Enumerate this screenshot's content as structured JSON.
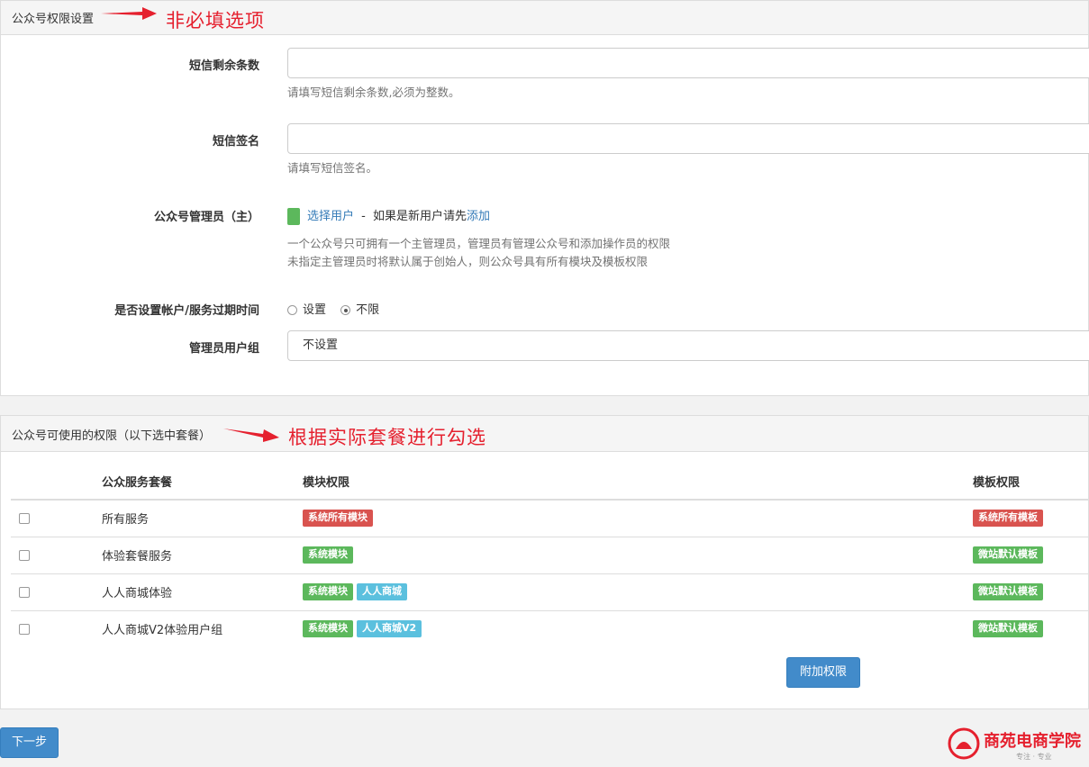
{
  "section1": {
    "title": "公众号权限设置",
    "annotation": "非必填选项",
    "sms_count": {
      "label": "短信剩余条数",
      "value": "",
      "help": "请填写短信剩余条数,必须为整数。"
    },
    "sms_sign": {
      "label": "短信签名",
      "value": "",
      "help": "请填写短信签名。"
    },
    "admin": {
      "label": "公众号管理员（主）",
      "select_user": "选择用户",
      "separator": "-",
      "new_user_prefix": "如果是新用户请先",
      "add_link": "添加",
      "help_line1": "一个公众号只可拥有一个主管理员，管理员有管理公众号和添加操作员的权限",
      "help_line2": "未指定主管理员时将默认属于创始人，则公众号具有所有模块及模板权限"
    },
    "expiry": {
      "label": "是否设置帐户/服务过期时间",
      "option_set": "设置",
      "option_unlimited": "不限",
      "selected": "不限"
    },
    "user_group": {
      "label": "管理员用户组",
      "value": "不设置"
    }
  },
  "section2": {
    "title": "公众号可使用的权限（以下选中套餐）",
    "annotation": "根据实际套餐进行勾选",
    "headers": {
      "package": "公众服务套餐",
      "modules": "模块权限",
      "templates": "模板权限"
    },
    "rows": [
      {
        "name": "所有服务",
        "checked": false,
        "modules": [
          {
            "text": "系统所有模块",
            "style": "danger"
          }
        ],
        "templates": [
          {
            "text": "系统所有模板",
            "style": "danger"
          }
        ]
      },
      {
        "name": "体验套餐服务",
        "checked": false,
        "modules": [
          {
            "text": "系统模块",
            "style": "success"
          }
        ],
        "templates": [
          {
            "text": "微站默认模板",
            "style": "success"
          }
        ]
      },
      {
        "name": "人人商城体验",
        "checked": false,
        "modules": [
          {
            "text": "系统模块",
            "style": "success"
          },
          {
            "text": "人人商城",
            "style": "info"
          }
        ],
        "templates": [
          {
            "text": "微站默认模板",
            "style": "success"
          }
        ]
      },
      {
        "name": "人人商城V2体验用户组",
        "checked": false,
        "modules": [
          {
            "text": "系统模块",
            "style": "success"
          },
          {
            "text": "人人商城V2",
            "style": "info"
          }
        ],
        "templates": [
          {
            "text": "微站默认模板",
            "style": "success"
          }
        ]
      }
    ],
    "extra_button": "附加权限"
  },
  "footer": {
    "next_button": "下一步"
  },
  "watermark": {
    "text": "商苑电商学院",
    "tagline": "专注 · 专业"
  },
  "colors": {
    "annotation": "#e5202e",
    "primary": "#428bca",
    "danger": "#d9534f",
    "success": "#5cb85c",
    "info": "#5bc0de"
  }
}
